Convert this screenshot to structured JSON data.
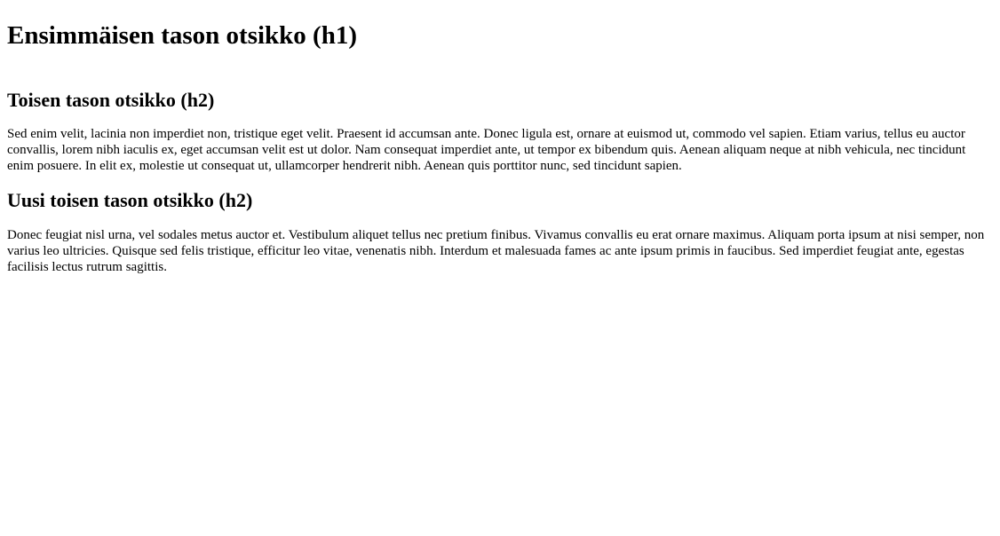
{
  "document": {
    "heading_h1": "Ensimmäisen tason otsikko (h1)",
    "heading_h2_first": "Toisen tason otsikko (h2)",
    "paragraph_first": "Sed enim velit, lacinia non imperdiet non, tristique eget velit. Praesent id accumsan ante. Donec ligula est, ornare at euismod ut, commodo vel sapien. Etiam varius, tellus eu auctor convallis, lorem nibh iaculis ex, eget accumsan velit est ut dolor. Nam consequat imperdiet ante, ut tempor ex bibendum quis. Aenean aliquam neque at nibh vehicula, nec tincidunt enim posuere. In elit ex, molestie ut consequat ut, ullamcorper hendrerit nibh. Aenean quis porttitor nunc, sed tincidunt sapien.",
    "heading_h2_second": "Uusi toisen tason otsikko (h2)",
    "paragraph_second": "Donec feugiat nisl urna, vel sodales metus auctor et. Vestibulum aliquet tellus nec pretium finibus. Vivamus convallis eu erat ornare maximus. Aliquam porta ipsum at nisi semper, non varius leo ultricies. Quisque sed felis tristique, efficitur leo vitae, venenatis nibh. Interdum et malesuada fames ac ante ipsum primis in faucibus. Sed imperdiet feugiat ante, egestas facilisis lectus rutrum sagittis."
  }
}
